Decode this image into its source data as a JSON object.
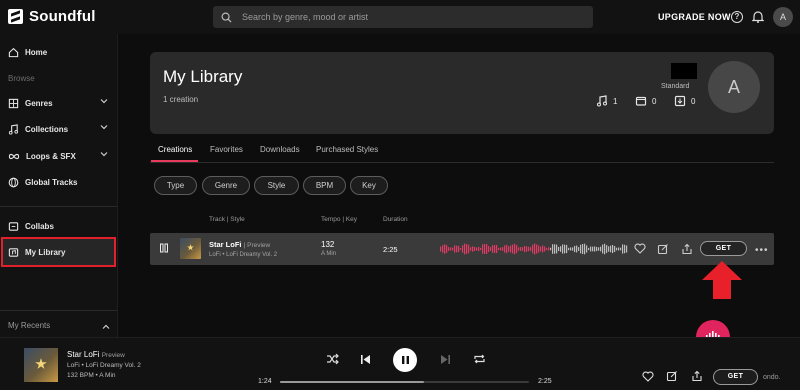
{
  "app": {
    "name": "Soundful"
  },
  "topbar": {
    "search_placeholder": "Search by genre, mood or artist",
    "upgrade_label": "UPGRADE NOW",
    "help_glyph": "?",
    "avatar_initial": "A",
    "icons": [
      "logo-icon",
      "search-icon",
      "help-icon",
      "bell-icon"
    ]
  },
  "sidebar": {
    "home": "Home",
    "browse_label": "Browse",
    "genres": "Genres",
    "collections": "Collections",
    "loops": "Loops & SFX",
    "global": "Global Tracks",
    "collabs": "Collabs",
    "library": "My Library",
    "recents": "My Recents",
    "highlight_color": "#e0202a"
  },
  "header": {
    "title": "My Library",
    "count": "1 creation",
    "plan": "Standard",
    "avatar_initial": "A",
    "stats": {
      "tracks": "1",
      "saved": "0",
      "downloads": "0"
    }
  },
  "tabs": {
    "creations": "Creations",
    "favorites": "Favorites",
    "downloads": "Downloads",
    "purchased": "Purchased Styles",
    "active": "Creations"
  },
  "filters": [
    "Type",
    "Genre",
    "Style",
    "BPM",
    "Key"
  ],
  "table": {
    "head_track": "Track | Style",
    "head_tempo": "Tempo | Key",
    "head_duration": "Duration"
  },
  "track": {
    "title": "Star LoFi",
    "tag": "| Preview",
    "sub": "LoFi • LoFi Dreamy Vol. 2",
    "tempo": "132",
    "key": "A Min",
    "duration": "2:25",
    "get_label": "GET",
    "more_glyph": "•••",
    "waveform_played_color": "#e23a64",
    "waveform_rest_color": "#bdbdbd"
  },
  "player": {
    "title": "Star LoFi",
    "tag": "Preview",
    "sub": "LoFi • LoFi Dreamy Vol. 2",
    "meta": "132 BPM • A Min",
    "elapsed": "1:24",
    "total": "2:25",
    "progress": 0.58,
    "get_label": "GET"
  },
  "watermark": "ondo.",
  "accent_color": "#e0245e"
}
